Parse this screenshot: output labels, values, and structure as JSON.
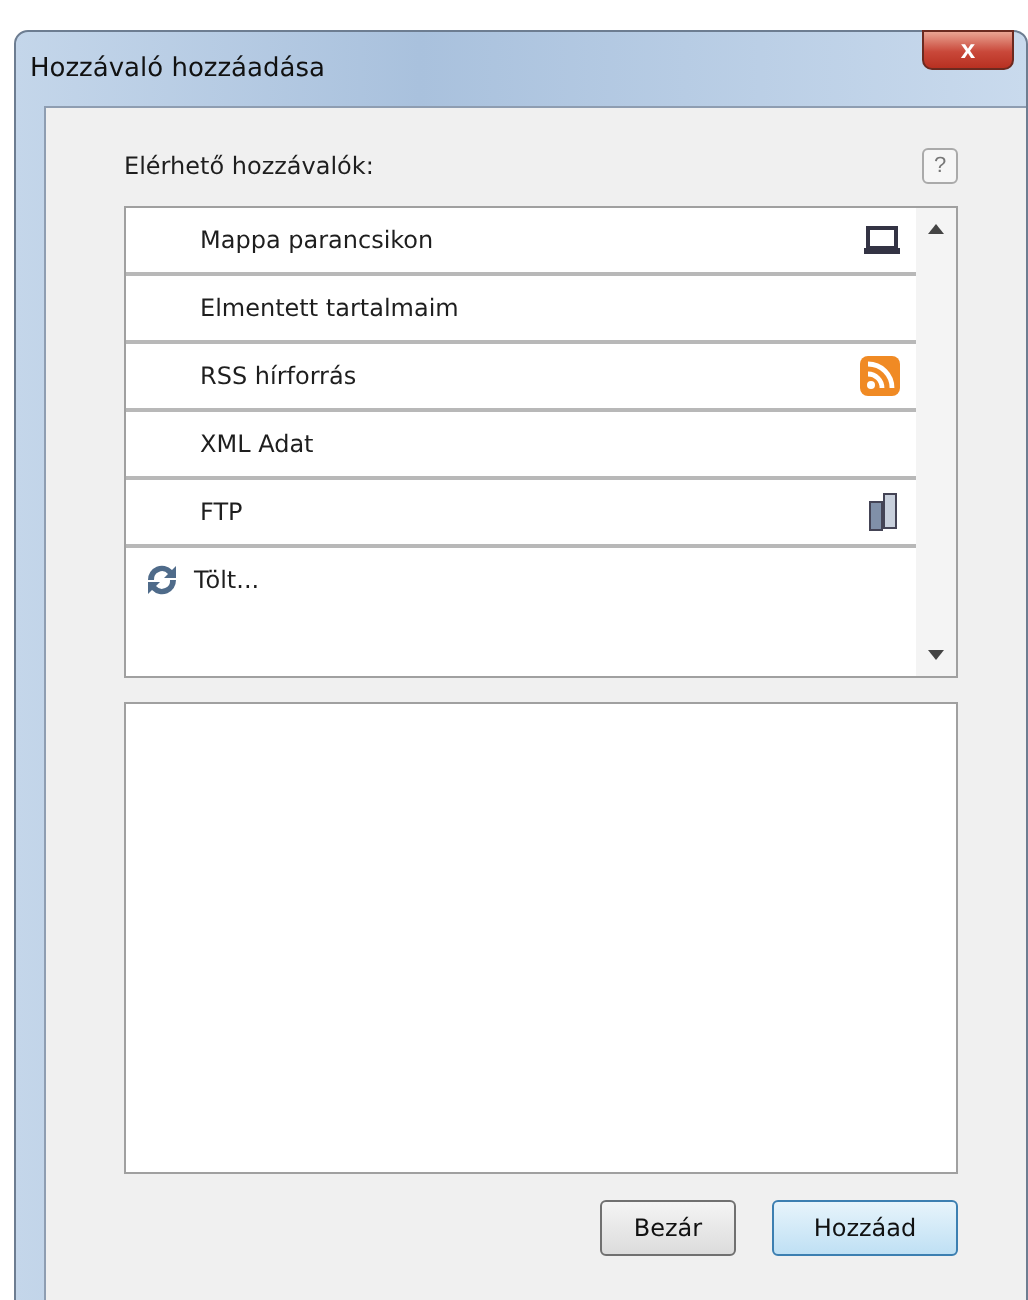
{
  "window": {
    "title": "Hozzávaló hozzáadása",
    "close_glyph": "x"
  },
  "list_label": "Elérhető hozzávalók:",
  "help_glyph": "?",
  "items": [
    {
      "kind": "laptop",
      "label": "Mappa parancsikon"
    },
    {
      "kind": "plain",
      "label": "Elmentett tartalmaim"
    },
    {
      "kind": "rss",
      "label": "RSS hírforrás"
    },
    {
      "kind": "plain",
      "label": "XML Adat"
    },
    {
      "kind": "server",
      "label": "FTP"
    },
    {
      "kind": "loading",
      "label": "Tölt..."
    }
  ],
  "buttons": [
    {
      "label": "Bezár",
      "default": false
    },
    {
      "label": "Hozzáad",
      "default": true
    }
  ]
}
